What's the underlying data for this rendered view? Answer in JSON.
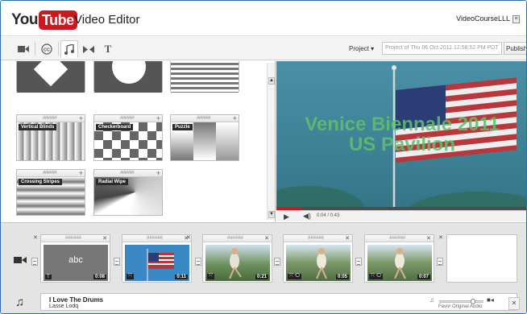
{
  "header": {
    "logo_you": "You",
    "logo_tube": "Tube",
    "title": "Video Editor",
    "user": "VideoCourseLLL"
  },
  "toolbar": {
    "tools": [
      "video-camera-icon",
      "cc-icon",
      "music-icon",
      "transition-icon",
      "text-icon"
    ],
    "project_label": "Project ▾",
    "project_value": "Project of Thu 06 Oct 2011 12:58:52 PM PDT",
    "publish_label": "Publish"
  },
  "transitions": [
    {
      "label": ""
    },
    {
      "label": ""
    },
    {
      "label": ""
    },
    {
      "label": "Vertical Blinds"
    },
    {
      "label": "Checkerboard"
    },
    {
      "label": "Puzzle"
    },
    {
      "label": "Crossing Stripes"
    },
    {
      "label": "Radial Wipe"
    }
  ],
  "preview": {
    "title_line1": "Venice Biennale 2011",
    "title_line2": "US Pavilion",
    "time": "0:04 / 0:43",
    "progress": 0.1
  },
  "timeline": {
    "clips": [
      {
        "duration": "0:08",
        "text": "abc",
        "badge": "T"
      },
      {
        "duration": "0:11",
        "badge": "⤧"
      },
      {
        "duration": "0:21",
        "badge": "⤧"
      },
      {
        "duration": "0:05",
        "badge": "⤧ ⟲"
      },
      {
        "duration": "0:07",
        "badge": "⤧ ⟲"
      }
    ],
    "audio": {
      "track": "I Love The Drums",
      "artist": "Lasse Lodq",
      "favor_label": "Favor Original Audio",
      "mix_level": 0.8
    }
  }
}
